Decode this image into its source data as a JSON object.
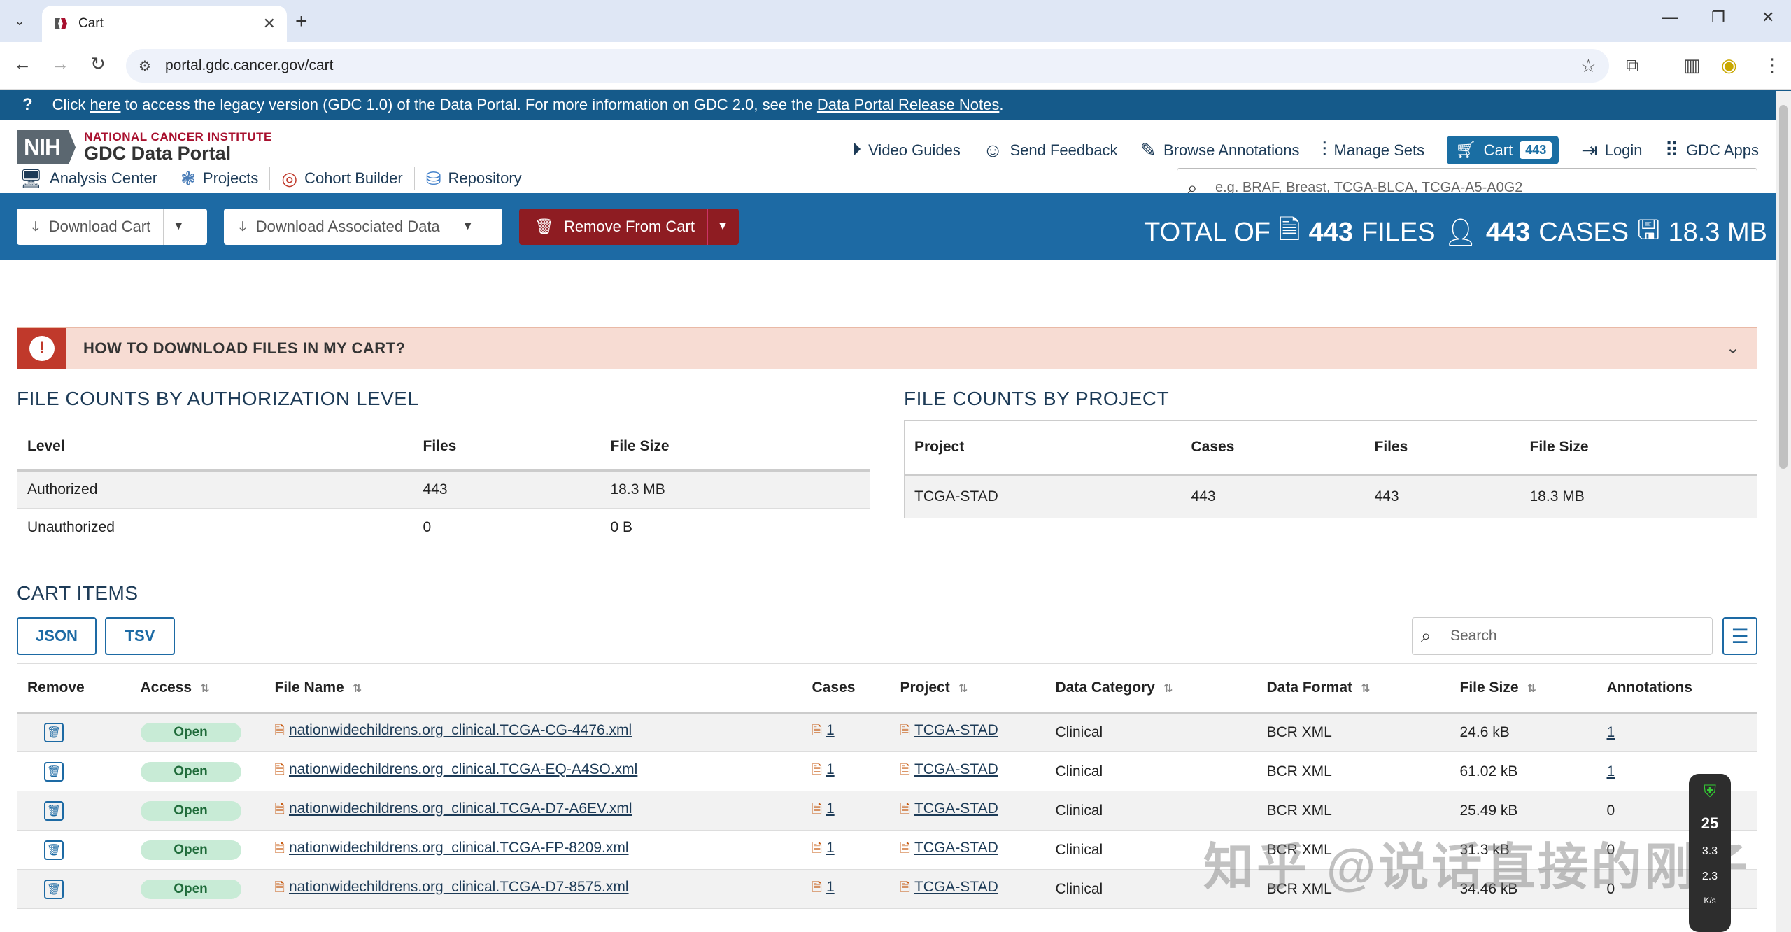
{
  "browser": {
    "tab_title": "Cart",
    "url": "portal.gdc.cancer.gov/cart"
  },
  "banner": {
    "prefix": "Click",
    "link1": "here",
    "middle": "to access the legacy version (GDC 1.0) of the Data Portal. For more information on GDC 2.0, see the",
    "link2": "Data Portal Release Notes",
    "suffix": "."
  },
  "logo": {
    "nih": "NIH",
    "institute": "NATIONAL CANCER INSTITUTE",
    "portal": "GDC Data Portal"
  },
  "topnav": {
    "video_guides": "Video Guides",
    "send_feedback": "Send Feedback",
    "browse_annotations": "Browse Annotations",
    "manage_sets": "Manage Sets",
    "cart": "Cart",
    "cart_count": "443",
    "login": "Login",
    "gdc_apps": "GDC Apps"
  },
  "subnav": {
    "analysis_center": "Analysis Center",
    "projects": "Projects",
    "cohort_builder": "Cohort Builder",
    "repository": "Repository"
  },
  "search": {
    "placeholder": "e.g. BRAF, Breast, TCGA-BLCA, TCGA-A5-A0G2"
  },
  "actions": {
    "download_cart": "Download Cart",
    "download_associated": "Download Associated Data",
    "remove_from_cart": "Remove From Cart"
  },
  "totals": {
    "prefix": "TOTAL OF",
    "files_count": "443",
    "files_label": "FILES",
    "cases_count": "443",
    "cases_label": "CASES",
    "size": "18.3 MB"
  },
  "howto": {
    "title": "HOW TO DOWNLOAD FILES IN MY CART?"
  },
  "auth_table": {
    "title": "FILE COUNTS BY AUTHORIZATION LEVEL",
    "headers": [
      "Level",
      "Files",
      "File Size"
    ],
    "rows": [
      [
        "Authorized",
        "443",
        "18.3 MB"
      ],
      [
        "Unauthorized",
        "0",
        "0 B"
      ]
    ]
  },
  "project_table": {
    "title": "FILE COUNTS BY PROJECT",
    "headers": [
      "Project",
      "Cases",
      "Files",
      "File Size"
    ],
    "rows": [
      [
        "TCGA-STAD",
        "443",
        "443",
        "18.3 MB"
      ]
    ]
  },
  "cart_items": {
    "title": "CART ITEMS",
    "json_btn": "JSON",
    "tsv_btn": "TSV",
    "search_placeholder": "Search",
    "headers": [
      "Remove",
      "Access",
      "File Name",
      "Cases",
      "Project",
      "Data Category",
      "Data Format",
      "File Size",
      "Annotations"
    ],
    "rows": [
      {
        "access": "Open",
        "file": "nationwidechildrens.org_clinical.TCGA-CG-4476.xml",
        "cases": "1",
        "project": "TCGA-STAD",
        "category": "Clinical",
        "format": "BCR XML",
        "size": "24.6 kB",
        "annotations": "1"
      },
      {
        "access": "Open",
        "file": "nationwidechildrens.org_clinical.TCGA-EQ-A4SO.xml",
        "cases": "1",
        "project": "TCGA-STAD",
        "category": "Clinical",
        "format": "BCR XML",
        "size": "61.02 kB",
        "annotations": "1"
      },
      {
        "access": "Open",
        "file": "nationwidechildrens.org_clinical.TCGA-D7-A6EV.xml",
        "cases": "1",
        "project": "TCGA-STAD",
        "category": "Clinical",
        "format": "BCR XML",
        "size": "25.49 kB",
        "annotations": "0"
      },
      {
        "access": "Open",
        "file": "nationwidechildrens.org_clinical.TCGA-FP-8209.xml",
        "cases": "1",
        "project": "TCGA-STAD",
        "category": "Clinical",
        "format": "BCR XML",
        "size": "31.3 kB",
        "annotations": "0"
      },
      {
        "access": "Open",
        "file": "nationwidechildrens.org_clinical.TCGA-D7-8575.xml",
        "cases": "1",
        "project": "TCGA-STAD",
        "category": "Clinical",
        "format": "BCR XML",
        "size": "34.46 kB",
        "annotations": "0"
      }
    ]
  },
  "watermark": "知乎 @说话直接的刚子",
  "widget": {
    "num": "25",
    "up": "3.3",
    "down": "2.3",
    "unit": "K/s"
  }
}
